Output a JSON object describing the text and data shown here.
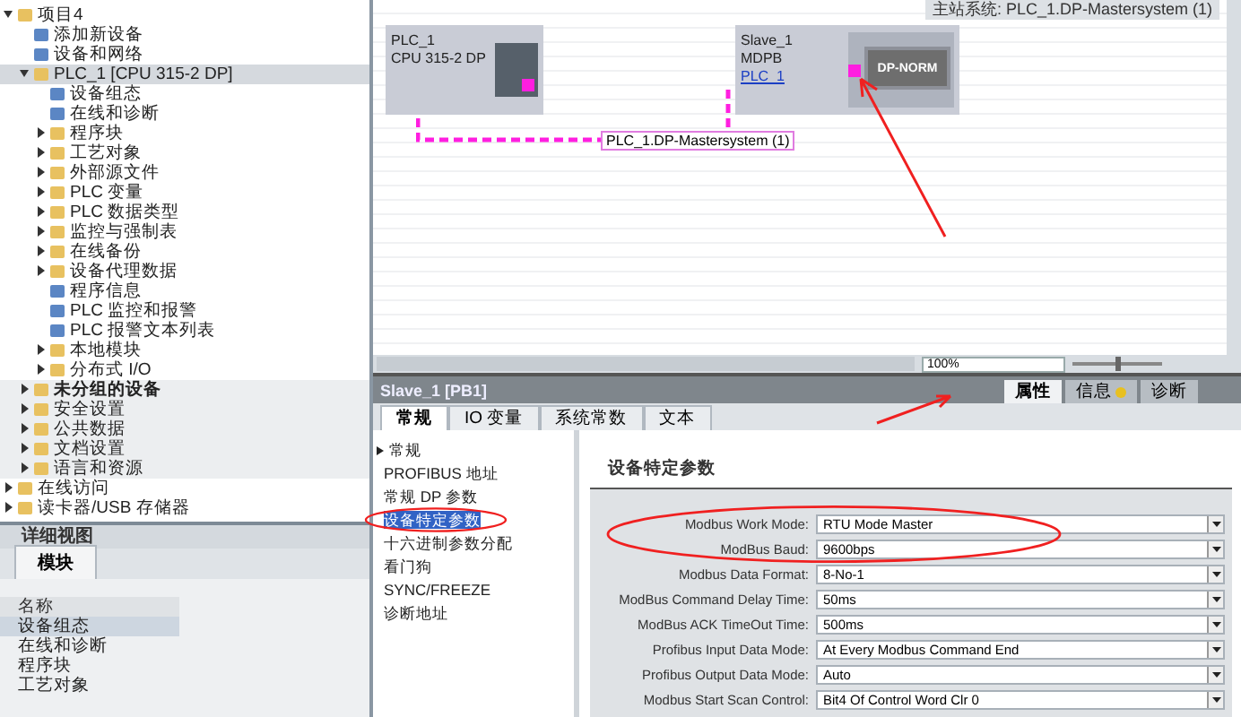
{
  "project_tree": {
    "items": [
      {
        "label": "项目4",
        "expanded": true,
        "selected": false,
        "children": [
          {
            "label": "添加新设备",
            "selected": false
          },
          {
            "label": "设备和网络",
            "selected": false
          },
          {
            "label": "PLC_1 [CPU 315-2 DP]",
            "expanded": true,
            "selected": true,
            "children": [
              {
                "label": "设备组态",
                "selected": false
              },
              {
                "label": "在线和诊断",
                "selected": false
              },
              {
                "label": "程序块",
                "expanded": false,
                "selected": false
              },
              {
                "label": "工艺对象",
                "expanded": false,
                "selected": false
              },
              {
                "label": "外部源文件",
                "expanded": false,
                "selected": false
              },
              {
                "label": "PLC 变量",
                "expanded": false,
                "selected": false
              },
              {
                "label": "PLC 数据类型",
                "expanded": false,
                "selected": false
              },
              {
                "label": "监控与强制表",
                "expanded": false,
                "selected": false
              },
              {
                "label": "在线备份",
                "expanded": false,
                "selected": false
              },
              {
                "label": "设备代理数据",
                "expanded": false,
                "selected": false
              },
              {
                "label": "程序信息",
                "selected": false
              },
              {
                "label": "PLC 监控和报警",
                "selected": false
              },
              {
                "label": "PLC 报警文本列表",
                "selected": false
              },
              {
                "label": "本地模块",
                "expanded": false,
                "selected": false
              },
              {
                "label": "分布式 I/O",
                "expanded": false,
                "selected": false
              }
            ]
          },
          {
            "label": "未分组的设备",
            "expanded": false,
            "selected": false
          },
          {
            "label": "安全设置",
            "expanded": false,
            "selected": false
          },
          {
            "label": "公共数据",
            "expanded": false,
            "selected": false
          },
          {
            "label": "文档设置",
            "expanded": false,
            "selected": false
          },
          {
            "label": "语言和资源",
            "expanded": false,
            "selected": false
          }
        ]
      },
      {
        "label": "在线访问",
        "expanded": false,
        "selected": false
      },
      {
        "label": "读卡器/USB 存储器",
        "expanded": false,
        "selected": false
      }
    ]
  },
  "detail_view": {
    "title": "详细视图",
    "tab": "模块",
    "column": "名称",
    "rows": [
      {
        "label": "设备组态",
        "selected": true
      },
      {
        "label": "在线和诊断",
        "selected": false
      },
      {
        "label": "程序块",
        "selected": false
      },
      {
        "label": "工艺对象",
        "selected": false
      }
    ]
  },
  "network_view": {
    "master_system_label": "主站系统: PLC_1.DP-Mastersystem (1)",
    "devices": [
      {
        "name": "PLC_1",
        "type": "CPU 315-2 DP",
        "kind": "master"
      },
      {
        "name": "Slave_1",
        "type": "MDPB",
        "link": "PLC_1",
        "module": "DP-NORM",
        "kind": "slave"
      }
    ],
    "subnet_label": "PLC_1.DP-Mastersystem (1)",
    "zoom": "100%",
    "zoom_slider": {
      "level": 0.5
    }
  },
  "inspector": {
    "title": "Slave_1 [PB1]",
    "panel_tabs": [
      {
        "label": "属性",
        "selected": true
      },
      {
        "label": "信息",
        "selected": false
      },
      {
        "label": "诊断",
        "selected": false
      }
    ],
    "tabs": [
      {
        "label": "常规",
        "selected": true
      },
      {
        "label": "IO 变量",
        "selected": false
      },
      {
        "label": "系统常数",
        "selected": false
      },
      {
        "label": "文本",
        "selected": false
      }
    ],
    "nav": [
      {
        "label": "常规",
        "selected": false
      },
      {
        "label": "PROFIBUS 地址",
        "selected": false
      },
      {
        "label": "常规 DP 参数",
        "selected": false
      },
      {
        "label": "设备特定参数",
        "selected": true
      },
      {
        "label": "十六进制参数分配",
        "selected": false
      },
      {
        "label": "看门狗",
        "selected": false
      },
      {
        "label": "SYNC/FREEZE",
        "selected": false
      },
      {
        "label": "诊断地址",
        "selected": false
      }
    ],
    "section_title": "设备特定参数",
    "params": [
      {
        "label": "Modbus Work Mode:",
        "value": "RTU Mode Master"
      },
      {
        "label": "ModBus Baud:",
        "value": "9600bps"
      },
      {
        "label": "Modbus Data Format:",
        "value": "8-No-1"
      },
      {
        "label": "ModBus Command Delay Time:",
        "value": "50ms"
      },
      {
        "label": "ModBus ACK TimeOut Time:",
        "value": "500ms"
      },
      {
        "label": "Profibus Input Data Mode:",
        "value": "At Every Modbus Command End"
      },
      {
        "label": "Profibus Output Data Mode:",
        "value": "Auto"
      },
      {
        "label": "Modbus Start Scan Control:",
        "value": "Bit4 Of Control Word Clr 0"
      }
    ]
  }
}
